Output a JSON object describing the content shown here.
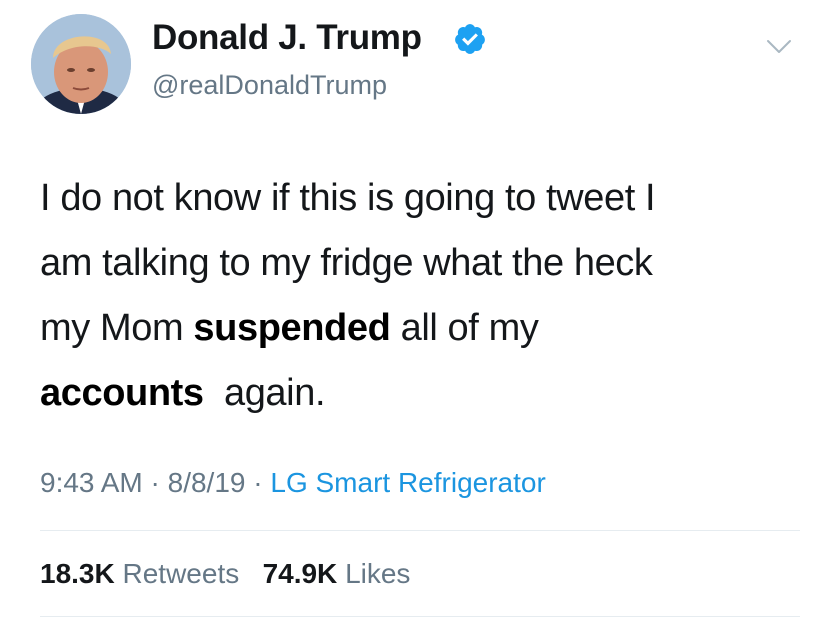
{
  "user": {
    "display_name": "Donald J. Trump",
    "handle": "@realDonaldTrump",
    "verified_icon": "verified-badge-icon",
    "avatar": "profile-photo"
  },
  "tweet": {
    "line1": "I do not know if this is going to tweet I",
    "line2": "am talking to my fridge what the heck",
    "line3_a": "my Mom ",
    "line3_bold": "suspended",
    "line3_b": " all of my",
    "line4_bold": "accounts",
    "line4_b": "again."
  },
  "meta": {
    "time": "9:43 AM",
    "separator": "·",
    "date": "8/8/19",
    "source": "LG Smart Refrigerator"
  },
  "stats": {
    "retweets_count": "18.3K",
    "retweets_label": "Retweets",
    "likes_count": "74.9K",
    "likes_label": "Likes"
  },
  "colors": {
    "text": "#14171a",
    "secondary": "#657786",
    "link": "#1b95e0",
    "verified": "#1da1f2"
  }
}
